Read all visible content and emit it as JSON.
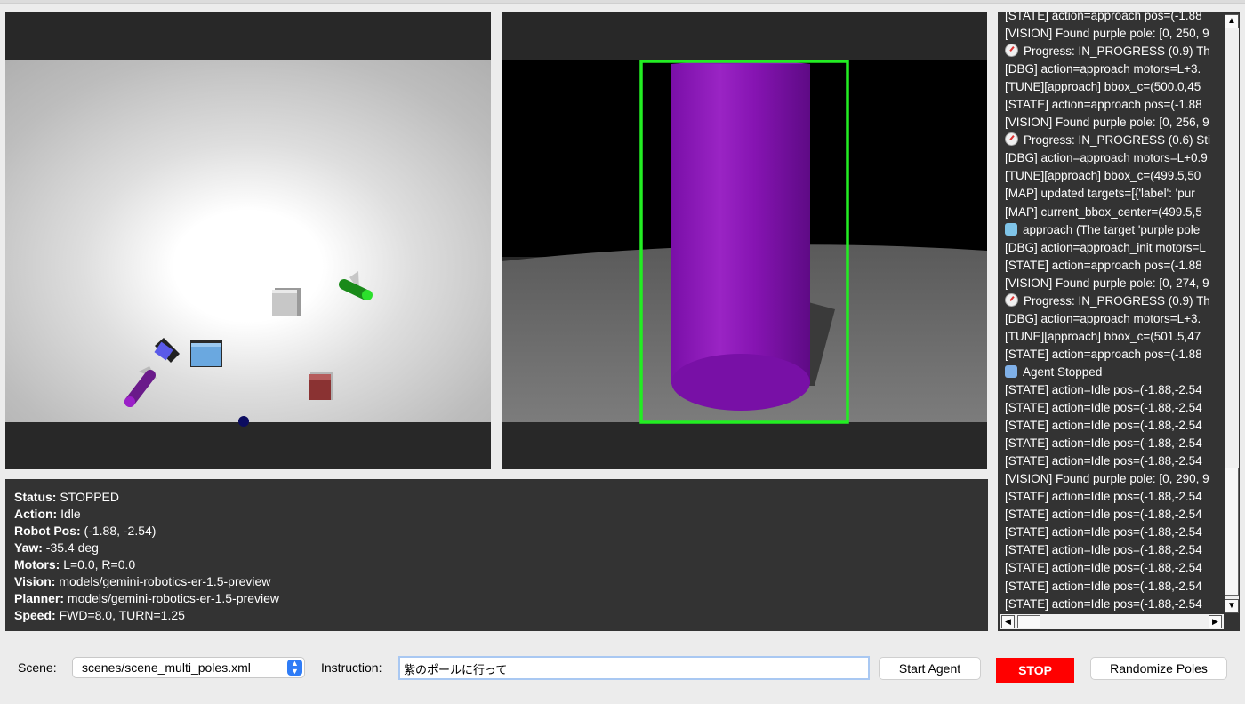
{
  "viewports": {
    "top_view": {
      "description": ""
    },
    "camera_view": {
      "description": ""
    }
  },
  "status": {
    "status_label": "Status:",
    "status_value": "STOPPED",
    "action_label": "Action:",
    "action_value": "Idle",
    "robot_pos_label": "Robot Pos:",
    "robot_pos_value": "(-1.88, -2.54)",
    "yaw_label": "Yaw:",
    "yaw_value": "-35.4 deg",
    "motors_label": "Motors:",
    "motors_value": "L=0.0, R=0.0",
    "vision_label": "Vision:",
    "vision_value": "models/gemini-robotics-er-1.5-preview",
    "planner_label": "Planner:",
    "planner_value": "models/gemini-robotics-er-1.5-preview",
    "speed_label": "Speed:",
    "speed_value": "FWD=8.0, TURN=1.25"
  },
  "log": {
    "lines": [
      {
        "icon": "",
        "text": "[STATE] action=approach pos=(-1.88"
      },
      {
        "icon": "",
        "text": "[VISION] Found purple pole: [0, 250, 9"
      },
      {
        "icon": "progress",
        "text": "Progress: IN_PROGRESS (0.9) Th"
      },
      {
        "icon": "",
        "text": "[DBG] action=approach motors=L+3."
      },
      {
        "icon": "",
        "text": "[TUNE][approach] bbox_c=(500.0,45"
      },
      {
        "icon": "",
        "text": "[STATE] action=approach pos=(-1.88"
      },
      {
        "icon": "",
        "text": "[VISION] Found purple pole: [0, 256, 9"
      },
      {
        "icon": "progress",
        "text": "Progress: IN_PROGRESS (0.6) Sti"
      },
      {
        "icon": "",
        "text": "[DBG] action=approach motors=L+0.9"
      },
      {
        "icon": "",
        "text": "[TUNE][approach] bbox_c=(499.5,50"
      },
      {
        "icon": "",
        "text": "[MAP] updated targets=[{'label': 'pur"
      },
      {
        "icon": "",
        "text": "[MAP] current_bbox_center=(499.5,5"
      },
      {
        "icon": "action",
        "text": "approach (The target 'purple pole"
      },
      {
        "icon": "",
        "text": "[DBG] action=approach_init motors=L"
      },
      {
        "icon": "",
        "text": "[STATE] action=approach pos=(-1.88"
      },
      {
        "icon": "",
        "text": "[VISION] Found purple pole: [0, 274, 9"
      },
      {
        "icon": "progress",
        "text": "Progress: IN_PROGRESS (0.9) Th"
      },
      {
        "icon": "",
        "text": "[DBG] action=approach motors=L+3."
      },
      {
        "icon": "",
        "text": "[TUNE][approach] bbox_c=(501.5,47"
      },
      {
        "icon": "",
        "text": "[STATE] action=approach pos=(-1.88"
      },
      {
        "icon": "stop",
        "text": "Agent Stopped"
      },
      {
        "icon": "",
        "text": "[STATE] action=Idle pos=(-1.88,-2.54"
      },
      {
        "icon": "",
        "text": "[STATE] action=Idle pos=(-1.88,-2.54"
      },
      {
        "icon": "",
        "text": "[STATE] action=Idle pos=(-1.88,-2.54"
      },
      {
        "icon": "",
        "text": "[STATE] action=Idle pos=(-1.88,-2.54"
      },
      {
        "icon": "",
        "text": "[STATE] action=Idle pos=(-1.88,-2.54"
      },
      {
        "icon": "",
        "text": "[VISION] Found purple pole: [0, 290, 9"
      },
      {
        "icon": "",
        "text": "[STATE] action=Idle pos=(-1.88,-2.54"
      },
      {
        "icon": "",
        "text": "[STATE] action=Idle pos=(-1.88,-2.54"
      },
      {
        "icon": "",
        "text": "[STATE] action=Idle pos=(-1.88,-2.54"
      },
      {
        "icon": "",
        "text": "[STATE] action=Idle pos=(-1.88,-2.54"
      },
      {
        "icon": "",
        "text": "[STATE] action=Idle pos=(-1.88,-2.54"
      },
      {
        "icon": "",
        "text": "[STATE] action=Idle pos=(-1.88,-2.54"
      },
      {
        "icon": "",
        "text": "[STATE] action=Idle pos=(-1.88,-2.54"
      }
    ]
  },
  "controls": {
    "scene_label": "Scene:",
    "scene_value": "scenes/scene_multi_poles.xml",
    "instruction_label": "Instruction:",
    "instruction_value": "紫のポールに行って",
    "start_label": "Start Agent",
    "stop_label": "STOP",
    "randomize_label": "Randomize Poles"
  },
  "colors": {
    "stop_button": "#ff0000",
    "detection_box": "#22ee22",
    "purple_pole": "#8a10b0",
    "panel_bg": "#333333"
  }
}
